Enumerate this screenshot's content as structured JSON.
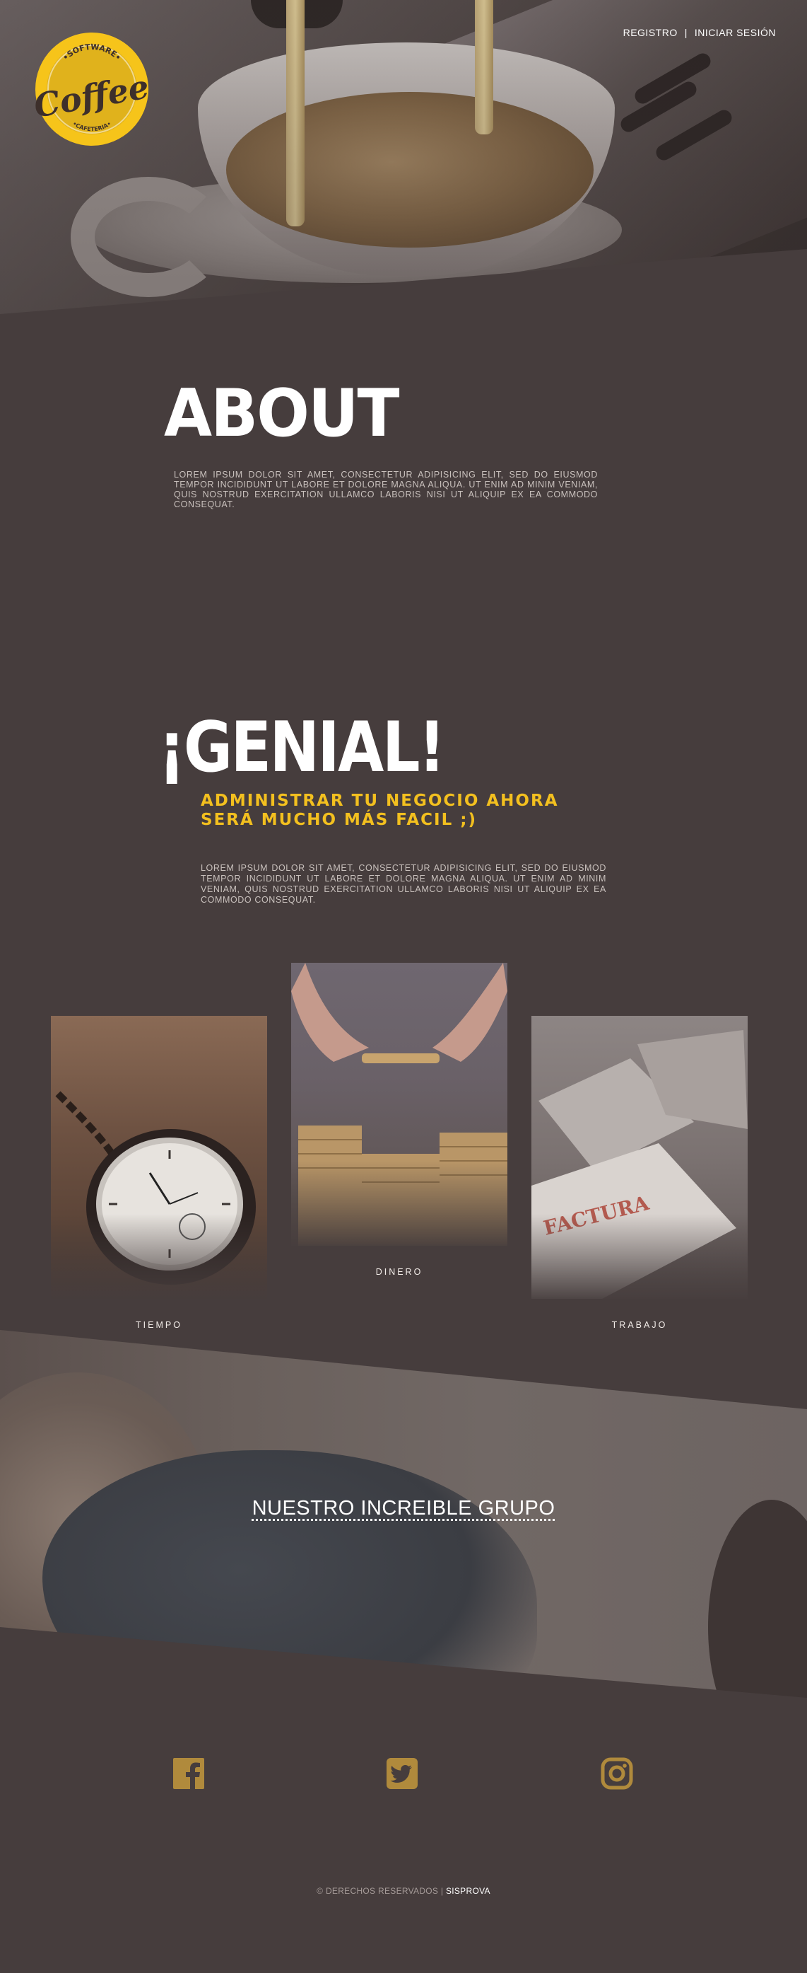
{
  "logo": {
    "top_text": "•SOFTWARE•",
    "word": "Coffee",
    "bottom_text": "•CAFETERIA•",
    "color": "#f6c41a"
  },
  "nav": {
    "register": "REGISTRO",
    "separator": "|",
    "login": "INICIAR SESIÓN"
  },
  "about": {
    "title": "ABOUT",
    "body": "LOREM IPSUM DOLOR SIT AMET, CONSECTETUR ADIPISICING ELIT, SED DO EIUSMOD TEMPOR INCIDIDUNT UT LABORE ET DOLORE MAGNA ALIQUA. UT ENIM AD MINIM VENIAM, QUIS NOSTRUD EXERCITATION ULLAMCO LABORIS NISI UT ALIQUIP EX EA COMMODO CONSEQUAT."
  },
  "genial": {
    "title": "¡GENIAL!",
    "subtitle": "ADMINISTRAR TU NEGOCIO AHORA SERÁ MUCHO MÁS FACIL ;)",
    "body": "LOREM IPSUM DOLOR SIT AMET, CONSECTETUR ADIPISICING ELIT, SED DO EIUSMOD TEMPOR INCIDIDUNT UT LABORE ET DOLORE MAGNA ALIQUA. UT ENIM AD MINIM VENIAM, QUIS NOSTRUD EXERCITATION ULLAMCO LABORIS NISI UT ALIQUIP EX EA COMMODO CONSEQUAT."
  },
  "cards": [
    {
      "caption": "TIEMPO",
      "icon": "pocket-watch"
    },
    {
      "caption": "DINERO",
      "icon": "coins"
    },
    {
      "caption": "TRABAJO",
      "icon": "factura-papers",
      "image_text": "FACTURA"
    }
  ],
  "team": {
    "title": "NUESTRO INCREIBLE GRUPO"
  },
  "social": [
    {
      "name": "facebook-icon"
    },
    {
      "name": "twitter-icon"
    },
    {
      "name": "instagram-icon"
    }
  ],
  "footer": {
    "text": "© DERECHOS RESERVADOS | ",
    "brand": "SISPROVA"
  },
  "colors": {
    "background": "#463d3d",
    "accent_yellow": "#f3c01f",
    "social_gold": "#b08a3c"
  }
}
